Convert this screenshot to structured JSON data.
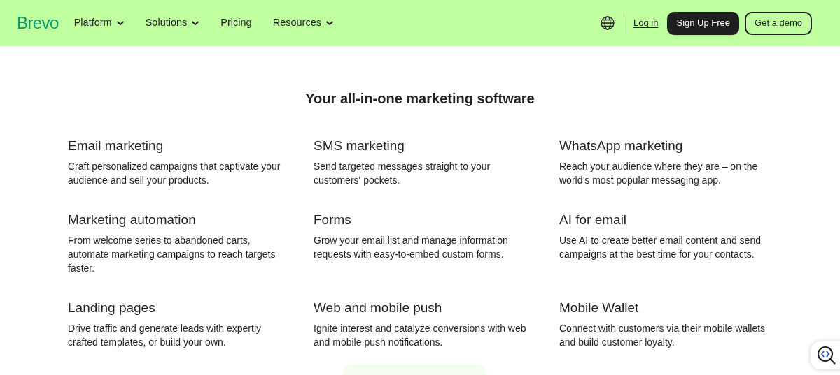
{
  "header": {
    "logo": "Brevo",
    "nav": [
      {
        "label": "Platform",
        "dropdown": true
      },
      {
        "label": "Solutions",
        "dropdown": true
      },
      {
        "label": "Pricing",
        "dropdown": false
      },
      {
        "label": "Resources",
        "dropdown": true
      }
    ],
    "login": "Log in",
    "signup": "Sign Up Free",
    "demo": "Get a demo"
  },
  "heading": "Your all-in-one marketing software",
  "features": [
    {
      "title": "Email marketing",
      "description": "Craft personalized campaigns that captivate your audience and sell your products."
    },
    {
      "title": "SMS marketing",
      "description": "Send targeted messages straight to your customers' pockets."
    },
    {
      "title": "WhatsApp marketing",
      "description": "Reach your audience where they are – on the world’s most popular messaging app."
    },
    {
      "title": "Marketing automation",
      "description": "From welcome series to abandoned carts, automate marketing campaigns to reach targets faster."
    },
    {
      "title": "Forms",
      "description": "Grow your email list and manage information requests with easy-to-embed custom forms."
    },
    {
      "title": "AI for email",
      "description": "Use AI to create better email content and send campaigns at the best time for your contacts."
    },
    {
      "title": "Landing pages",
      "description": "Drive traffic and generate leads with expertly crafted templates, or build your own."
    },
    {
      "title": "Web and mobile push",
      "description": "Ignite interest and catalyze conversions with web and mobile push notifications."
    },
    {
      "title": "Mobile Wallet",
      "description": "Connect with customers via their mobile wallets and build customer loyalty."
    }
  ]
}
